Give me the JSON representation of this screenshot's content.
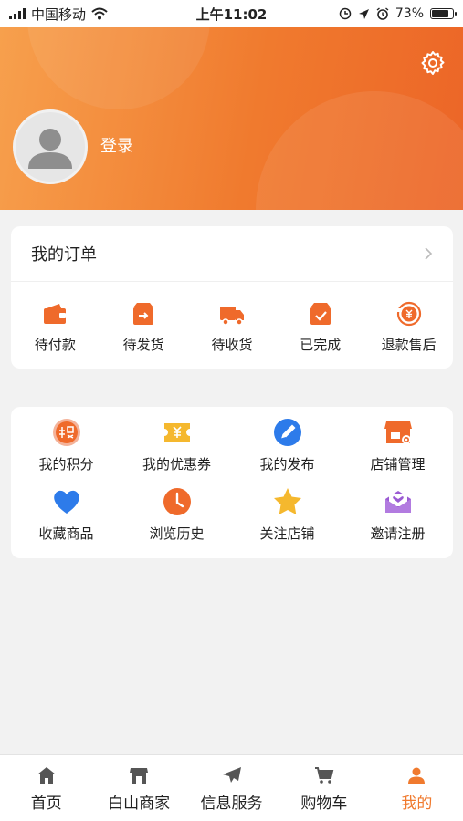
{
  "status_bar": {
    "carrier": "中国移动",
    "time": "上午11:02",
    "battery": "73%",
    "battery_level": 0.73
  },
  "profile": {
    "login_label": "登录"
  },
  "orders": {
    "title": "我的订单",
    "items": [
      {
        "label": "待付款",
        "icon": "wallet-icon"
      },
      {
        "label": "待发货",
        "icon": "ship-box-icon"
      },
      {
        "label": "待收货",
        "icon": "truck-icon"
      },
      {
        "label": "已完成",
        "icon": "completed-box-icon"
      },
      {
        "label": "退款售后",
        "icon": "refund-icon"
      }
    ]
  },
  "tools": {
    "items": [
      {
        "label": "我的积分",
        "icon": "points-icon"
      },
      {
        "label": "我的优惠券",
        "icon": "coupon-icon"
      },
      {
        "label": "我的发布",
        "icon": "publish-icon"
      },
      {
        "label": "店铺管理",
        "icon": "store-manage-icon"
      },
      {
        "label": "收藏商品",
        "icon": "heart-icon"
      },
      {
        "label": "浏览历史",
        "icon": "clock-icon"
      },
      {
        "label": "关注店铺",
        "icon": "star-icon"
      },
      {
        "label": "邀请注册",
        "icon": "invite-mail-icon"
      }
    ]
  },
  "tabbar": {
    "items": [
      {
        "label": "首页",
        "icon": "home-icon"
      },
      {
        "label": "白山商家",
        "icon": "shop-icon"
      },
      {
        "label": "信息服务",
        "icon": "send-icon"
      },
      {
        "label": "购物车",
        "icon": "cart-icon"
      },
      {
        "label": "我的",
        "icon": "person-icon",
        "active": true
      }
    ]
  },
  "colors": {
    "accent": "#f07a2e",
    "header_start": "#f7a04d",
    "header_end": "#ec6527",
    "blue": "#2d7bea",
    "purple": "#9b5bd3",
    "gold": "#f5b82e"
  }
}
